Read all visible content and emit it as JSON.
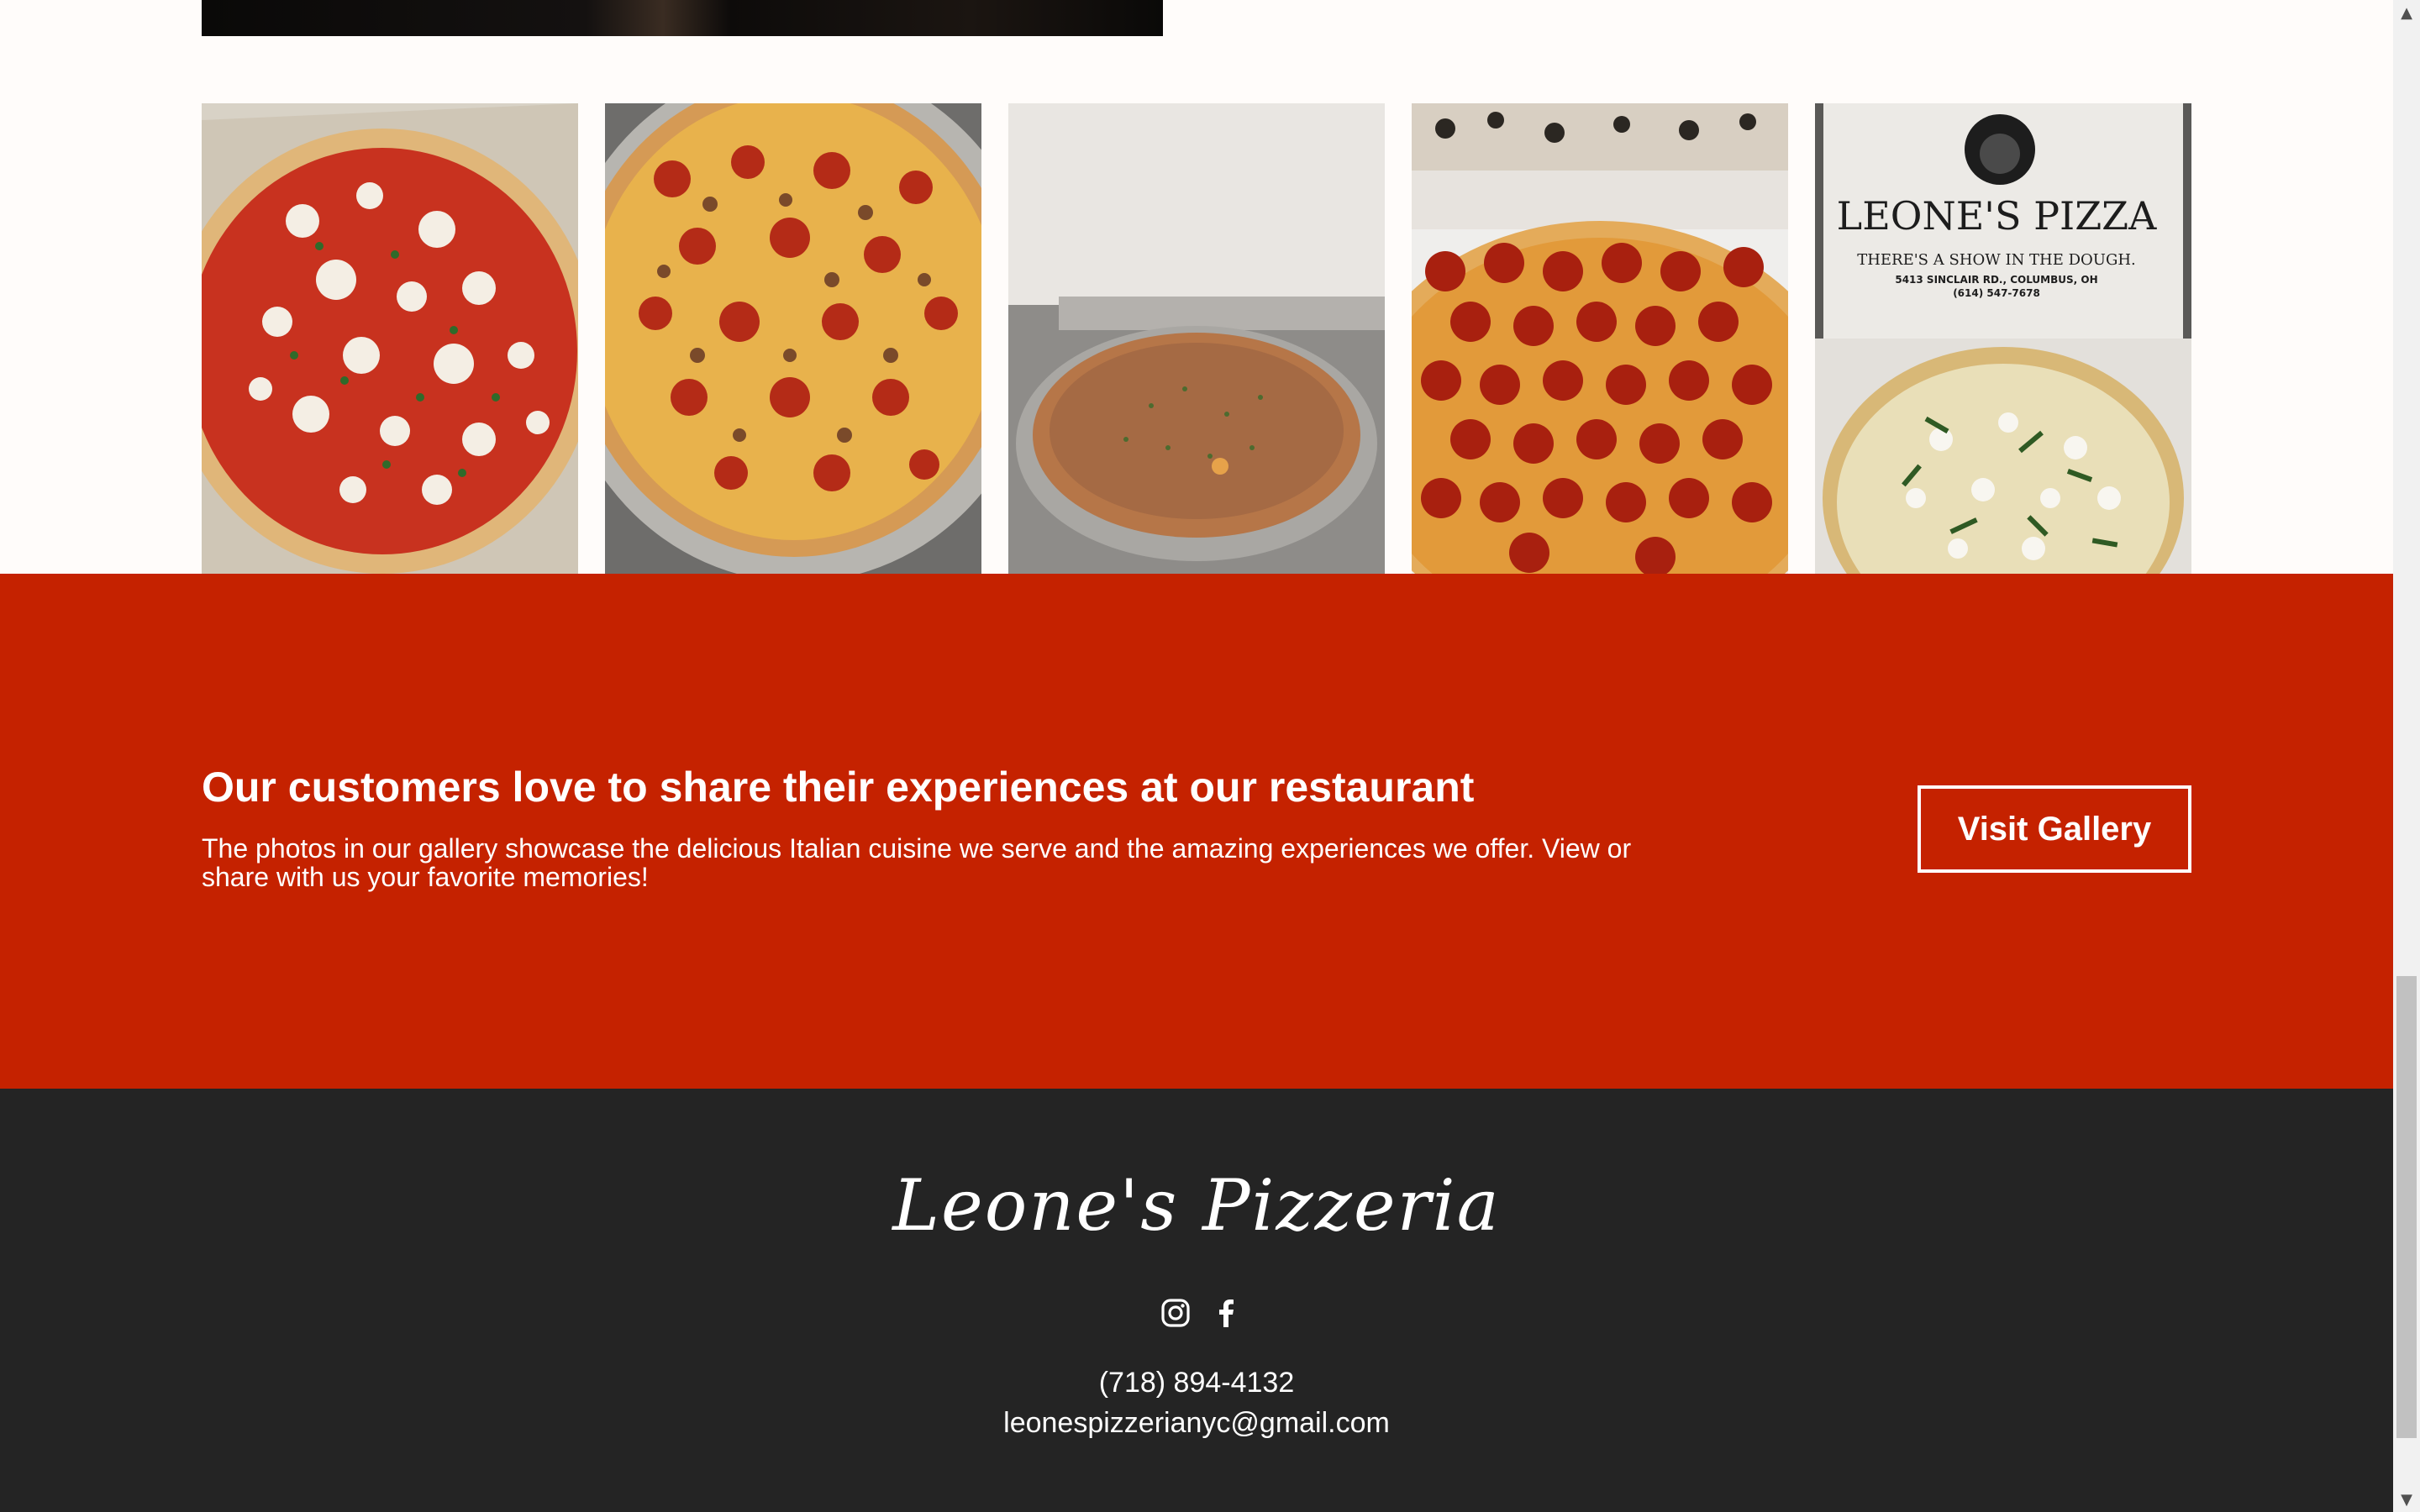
{
  "gallery": {
    "images": [
      {
        "alt": "pizza-margherita-photo"
      },
      {
        "alt": "pizza-pepperoni-sausage-photo"
      },
      {
        "alt": "pizza-garlic-photo"
      },
      {
        "alt": "pizza-pepperoni-photo"
      },
      {
        "alt": "pizza-box-leones-photo",
        "box_brand": "LEONE'S PIZZA",
        "box_tagline": "THERE'S A SHOW IN THE DOUGH.",
        "box_address": "5413 SINCLAIR RD., COLUMBUS, OH",
        "box_phone": "(614) 547-7678"
      }
    ]
  },
  "cta": {
    "heading": "Our customers love to share their experiences at our restaurant",
    "text": "The photos in our gallery showcase the delicious Italian cuisine we serve and the amazing experiences we offer. View or share with us your favorite memories!",
    "button_label": "Visit Gallery",
    "background_color": "#c52200"
  },
  "footer": {
    "brand": "Leone's Pizzeria",
    "social_icons": [
      "instagram-icon",
      "facebook-icon"
    ],
    "phone": "(718) 894-4132",
    "email": "leonespizzerianyc@gmail.com",
    "background_color": "#242424"
  },
  "scrollbar": {
    "up_arrow": "▲",
    "down_arrow": "▼"
  }
}
